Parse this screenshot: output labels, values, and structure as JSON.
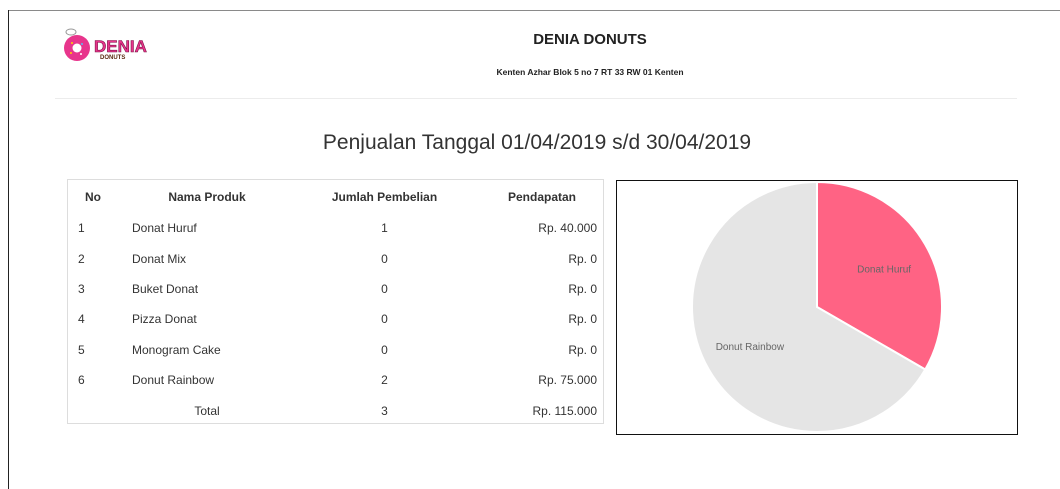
{
  "header": {
    "logo_text": "DENIA",
    "logo_subtext": "DONUTS",
    "company_name": "DENIA DONUTS",
    "address": "Kenten Azhar Blok 5 no 7 RT 33 RW 01 Kenten"
  },
  "report": {
    "title": "Penjualan Tanggal 01/04/2019 s/d 30/04/2019"
  },
  "table": {
    "columns": [
      "No",
      "Nama Produk",
      "Jumlah Pembelian",
      "Pendapatan"
    ],
    "rows": [
      {
        "no": "1",
        "name": "Donat Huruf",
        "qty": "1",
        "revenue": "Rp. 40.000"
      },
      {
        "no": "2",
        "name": "Donat Mix",
        "qty": "0",
        "revenue": "Rp. 0"
      },
      {
        "no": "3",
        "name": "Buket Donat",
        "qty": "0",
        "revenue": "Rp. 0"
      },
      {
        "no": "4",
        "name": "Pizza Donat",
        "qty": "0",
        "revenue": "Rp. 0"
      },
      {
        "no": "5",
        "name": "Monogram Cake",
        "qty": "0",
        "revenue": "Rp. 0"
      },
      {
        "no": "6",
        "name": "Donut Rainbow",
        "qty": "2",
        "revenue": "Rp. 75.000"
      }
    ],
    "total": {
      "label": "Total",
      "qty": "3",
      "revenue": "Rp. 115.000"
    }
  },
  "chart_data": {
    "type": "pie",
    "slices": [
      {
        "label": "Donat Huruf",
        "value": 1,
        "color": "#ff6384"
      },
      {
        "label": "Donut Rainbow",
        "value": 2,
        "color": "#e5e5e5"
      }
    ]
  }
}
